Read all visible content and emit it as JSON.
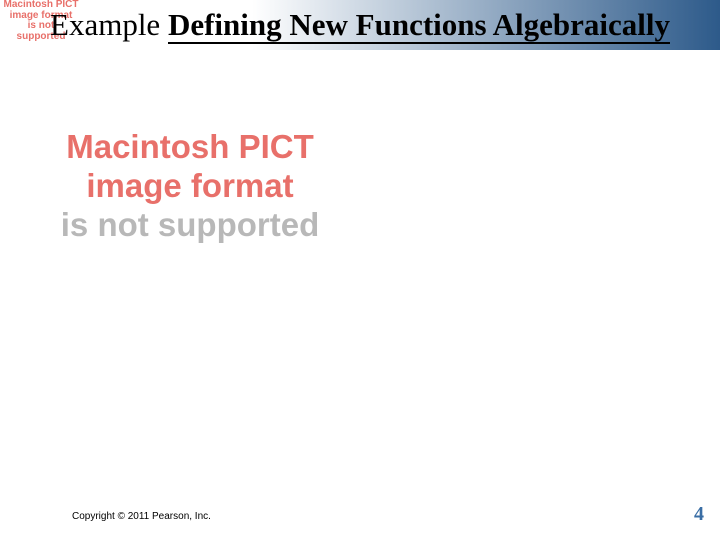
{
  "title": {
    "prefix": "Example ",
    "main": "Defining New Functions Algebraically"
  },
  "small_pict": {
    "line1": "Macintosh PICT",
    "line2": "image format",
    "line3": "is not supported"
  },
  "big_pict": {
    "line1": "Macintosh PICT",
    "line2": "image format",
    "line3": "is not supported"
  },
  "footer": {
    "copyright": "Copyright © 2011 Pearson, Inc.",
    "page_number": "4"
  },
  "colors": {
    "accent_blue": "#3a6ea5",
    "pict_red": "#e8706a",
    "pict_grey": "#b8b8b8"
  }
}
